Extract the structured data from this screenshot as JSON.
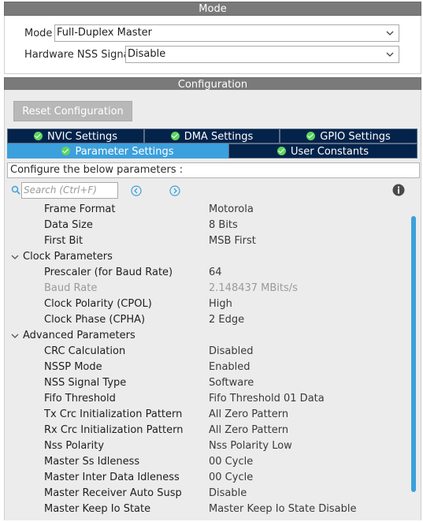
{
  "mode_section": {
    "title": "Mode",
    "mode_label": "Mode",
    "mode_value": "Full-Duplex Master",
    "nss_label": "Hardware NSS Signal",
    "nss_value": "Disable"
  },
  "config_section": {
    "title": "Configuration",
    "reset_label": "Reset Configuration",
    "tabs": [
      {
        "label": "NVIC Settings"
      },
      {
        "label": "DMA Settings"
      },
      {
        "label": "GPIO Settings"
      },
      {
        "label": "Parameter Settings"
      },
      {
        "label": "User Constants"
      }
    ],
    "hint": "Configure the below parameters :",
    "search_placeholder": "Search (Ctrl+F)"
  },
  "parameters": [
    {
      "name": "Frame Format",
      "value": "Motorola"
    },
    {
      "name": "Data Size",
      "value": "8 Bits"
    },
    {
      "name": "First Bit",
      "value": "MSB First"
    },
    {
      "name": "Clock Parameters",
      "value": ""
    },
    {
      "name": "Prescaler (for Baud Rate)",
      "value": "64"
    },
    {
      "name": "Baud Rate",
      "value": "2.148437 MBits/s"
    },
    {
      "name": "Clock Polarity (CPOL)",
      "value": "High"
    },
    {
      "name": "Clock Phase (CPHA)",
      "value": "2 Edge"
    },
    {
      "name": "Advanced Parameters",
      "value": ""
    },
    {
      "name": "CRC Calculation",
      "value": "Disabled"
    },
    {
      "name": "NSSP Mode",
      "value": "Enabled"
    },
    {
      "name": "NSS Signal Type",
      "value": "Software"
    },
    {
      "name": "Fifo Threshold",
      "value": "Fifo Threshold 01 Data"
    },
    {
      "name": "Tx Crc Initialization Pattern",
      "value": "All Zero Pattern"
    },
    {
      "name": "Rx Crc Initialization Pattern",
      "value": "All Zero Pattern"
    },
    {
      "name": "Nss Polarity",
      "value": "Nss Polarity Low"
    },
    {
      "name": "Master Ss Idleness",
      "value": "00 Cycle"
    },
    {
      "name": "Master Inter Data Idleness",
      "value": "00 Cycle"
    },
    {
      "name": "Master Receiver Auto Susp",
      "value": "Disable"
    },
    {
      "name": "Master Keep Io State",
      "value": "Master Keep Io State Disable"
    }
  ],
  "colors": {
    "tab_dark": "#03234b",
    "tab_active": "#3ca0dc",
    "header_gray": "#7a7a7a",
    "check_green": "#5cd65c"
  }
}
